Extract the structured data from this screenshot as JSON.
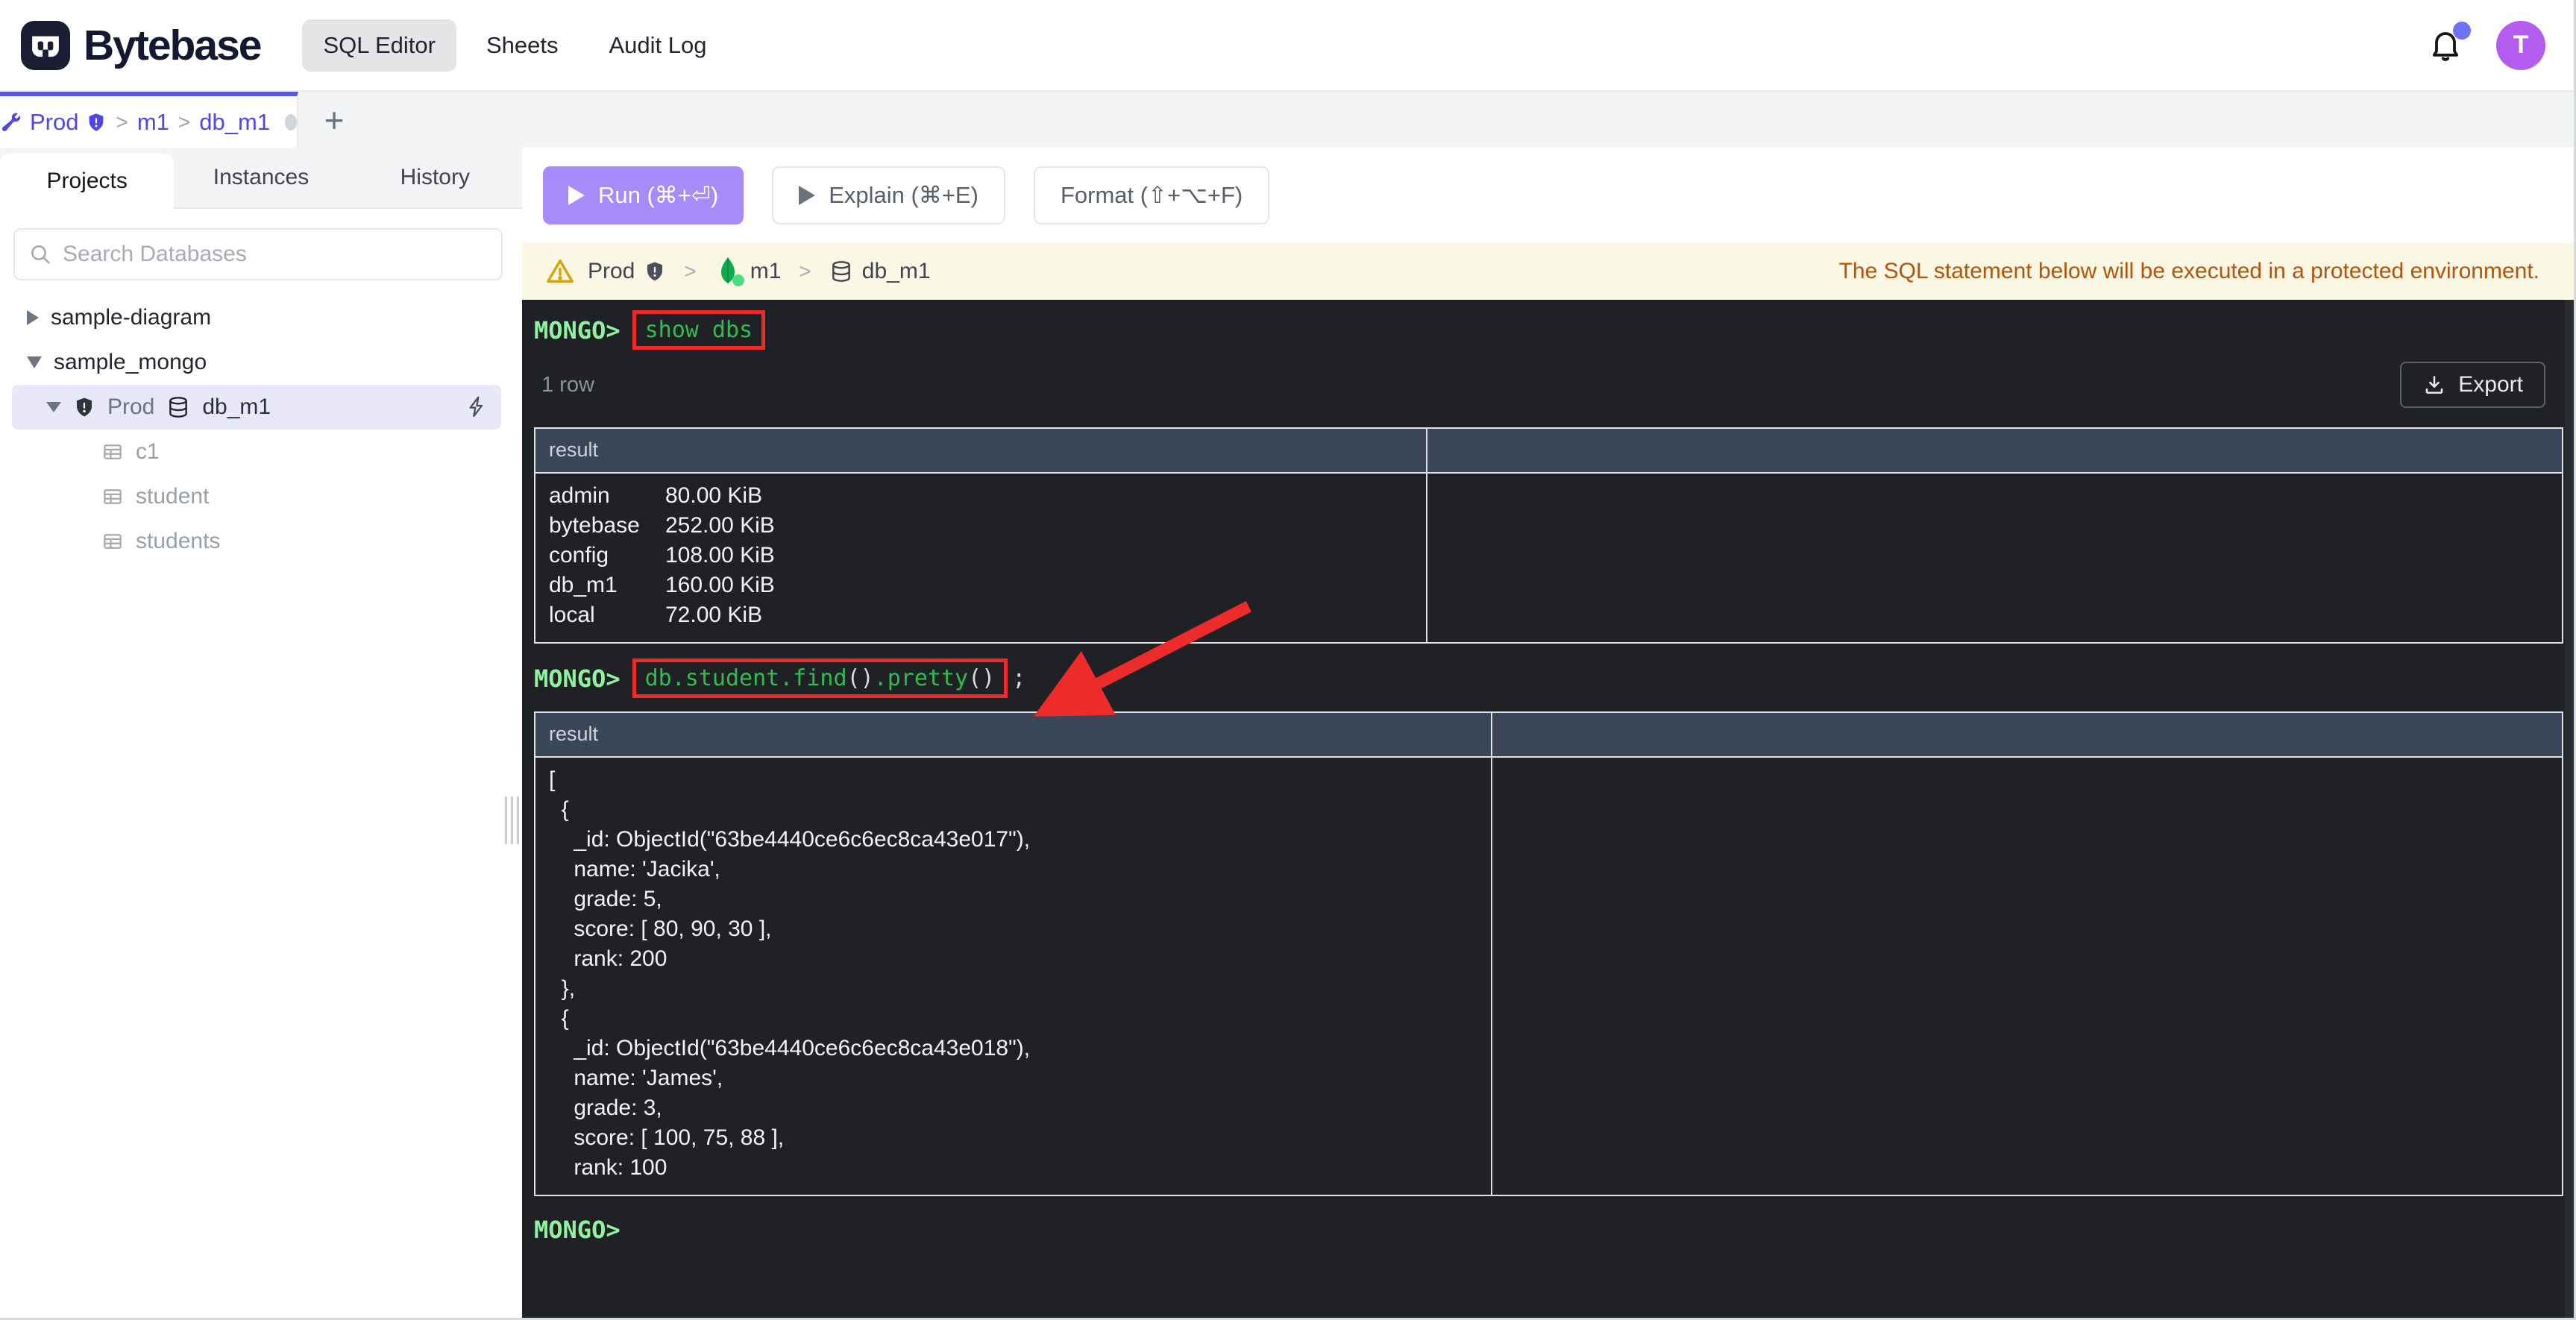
{
  "topbar": {
    "brand": "Bytebase",
    "nav": {
      "sql_editor": "SQL Editor",
      "sheets": "Sheets",
      "audit_log": "Audit Log"
    },
    "avatar_initial": "T"
  },
  "tab": {
    "project": "Prod",
    "instance": "m1",
    "database": "db_m1",
    "separator": ">",
    "new_tab_label": "+"
  },
  "sidebar": {
    "tabs": {
      "projects": "Projects",
      "instances": "Instances",
      "history": "History"
    },
    "active_tab": "Projects",
    "search_placeholder": "Search Databases",
    "tree": [
      {
        "label": "sample-diagram",
        "state": "collapsed"
      },
      {
        "label": "sample_mongo",
        "state": "expanded"
      },
      {
        "env": "Prod",
        "db": "db_m1",
        "selected": true
      },
      {
        "label": "c1"
      },
      {
        "label": "student"
      },
      {
        "label": "students"
      }
    ]
  },
  "toolbar": {
    "run_label": "Run (⌘+⏎)",
    "explain_label": "Explain (⌘+E)",
    "format_label": "Format (⇧+⌥+F)"
  },
  "warning": {
    "env": "Prod",
    "instance": "m1",
    "database": "db_m1",
    "separator": ">",
    "message": "The SQL statement below will be executed in a protected environment."
  },
  "terminal": {
    "prompt": "MONGO>",
    "command1": "show dbs",
    "command2": {
      "segments": [
        {
          "text": "db.student.find",
          "kind": "code"
        },
        {
          "text": "()",
          "kind": "plain"
        },
        {
          "text": ".pretty",
          "kind": "code"
        },
        {
          "text": "()",
          "kind": "plain"
        }
      ],
      "suffix": ";"
    },
    "row_count": "1 row",
    "export_label": "Export",
    "result1": {
      "header": "result",
      "rows": [
        {
          "name": "admin",
          "size": "80.00 KiB"
        },
        {
          "name": "bytebase",
          "size": "252.00 KiB"
        },
        {
          "name": "config",
          "size": "108.00 KiB"
        },
        {
          "name": "db_m1",
          "size": "160.00 KiB"
        },
        {
          "name": "local",
          "size": "72.00 KiB"
        }
      ]
    },
    "result2": {
      "header": "result",
      "lines": [
        "[",
        "  {",
        "    _id: ObjectId(\"63be4440ce6c6ec8ca43e017\"),",
        "    name: 'Jacika',",
        "    grade: 5,",
        "    score: [ 80, 90, 30 ],",
        "    rank: 200",
        "  },",
        "  {",
        "    _id: ObjectId(\"63be4440ce6c6ec8ca43e018\"),",
        "    name: 'James',",
        "    grade: 3,",
        "    score: [ 100, 75, 88 ],",
        "    rank: 100"
      ]
    }
  },
  "colors": {
    "accent_purple": "#5a55ee",
    "breadcrumb": "#4f46e5",
    "run_button": "#a78bfa",
    "warning_bg": "#faf8e5",
    "warning_text": "#b45309",
    "terminal_bg": "#1f2124",
    "table_header": "#3b4759",
    "prompt_green": "#90f1a1",
    "command_green": "#2fbd52",
    "annotation_red": "#ee2b2b",
    "avatar_purple": "#b55cf0",
    "mongo_green": "#10aa50"
  }
}
